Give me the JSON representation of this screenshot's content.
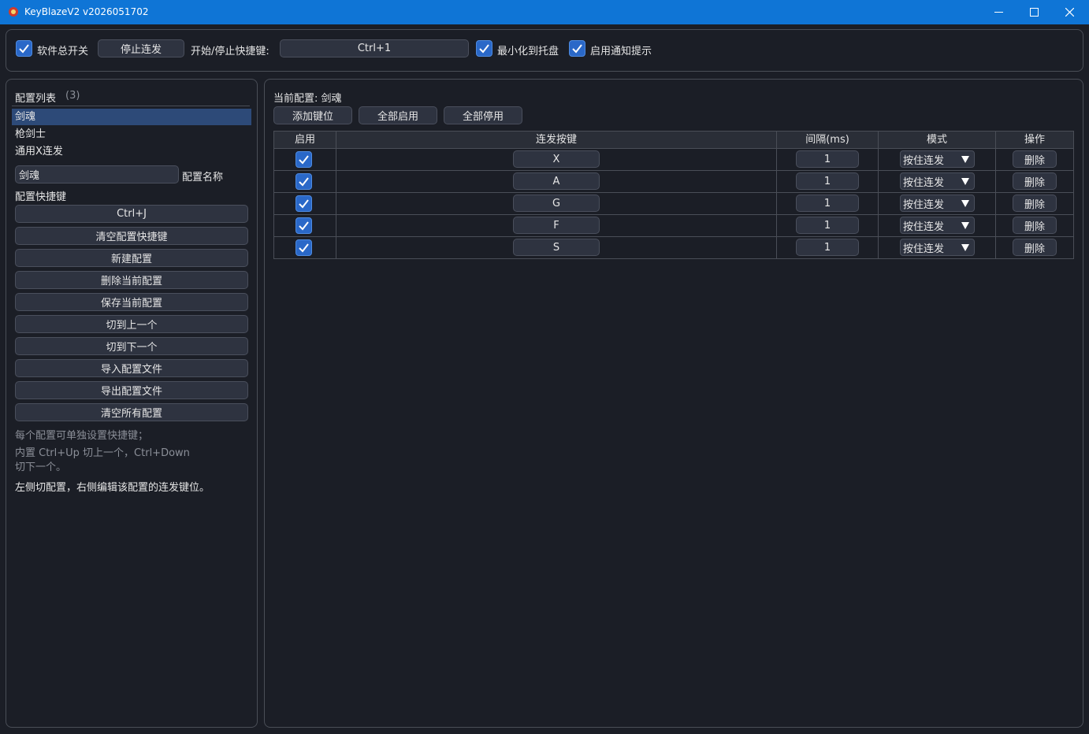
{
  "window": {
    "title": "KeyBlazeV2 v2026051702"
  },
  "toolbar": {
    "master_switch_label": "软件总开关",
    "stop_button": "停止连发",
    "hotkey_label": "开始/停止快捷键:",
    "hotkey_value": "Ctrl+1",
    "minimize_tray_label": "最小化到托盘",
    "notify_label": "启用通知提示"
  },
  "sidebar": {
    "title": "配置列表",
    "count": "(3)",
    "configs": [
      "剑魂",
      "枪剑士",
      "通用X连发"
    ],
    "selected_index": 0,
    "name_value": "剑魂",
    "name_label": "配置名称",
    "hotkey_title": "配置快捷键",
    "hotkey_value": "Ctrl+J",
    "buttons": {
      "clear_hotkey": "清空配置快捷键",
      "new": "新建配置",
      "delete": "删除当前配置",
      "save": "保存当前配置",
      "prev": "切到上一个",
      "next": "切到下一个",
      "import": "导入配置文件",
      "export": "导出配置文件",
      "clear_all": "清空所有配置"
    },
    "hint1": "每个配置可单独设置快捷键；",
    "hint2a": "内置 Ctrl+Up 切上一个，Ctrl+Down",
    "hint2b": "切下一个。",
    "hint3": "左侧切配置，右侧编辑该配置的连发键位。"
  },
  "main": {
    "current_label": "当前配置: 剑魂",
    "add_key_button": "添加键位",
    "enable_all_button": "全部启用",
    "disable_all_button": "全部停用",
    "columns": [
      "启用",
      "连发按键",
      "间隔(ms)",
      "模式",
      "操作"
    ],
    "rows": [
      {
        "enabled": true,
        "key": "X",
        "interval": "1",
        "mode": "按住连发",
        "action": "删除"
      },
      {
        "enabled": true,
        "key": "A",
        "interval": "1",
        "mode": "按住连发",
        "action": "删除"
      },
      {
        "enabled": true,
        "key": "G",
        "interval": "1",
        "mode": "按住连发",
        "action": "删除"
      },
      {
        "enabled": true,
        "key": "F",
        "interval": "1",
        "mode": "按住连发",
        "action": "删除"
      },
      {
        "enabled": true,
        "key": "S",
        "interval": "1",
        "mode": "按住连发",
        "action": "删除"
      }
    ]
  },
  "colors": {
    "titlebar": "#0f75d6",
    "background": "#1b1e26",
    "accent": "#2a68c8",
    "selection": "#2d4a78"
  }
}
